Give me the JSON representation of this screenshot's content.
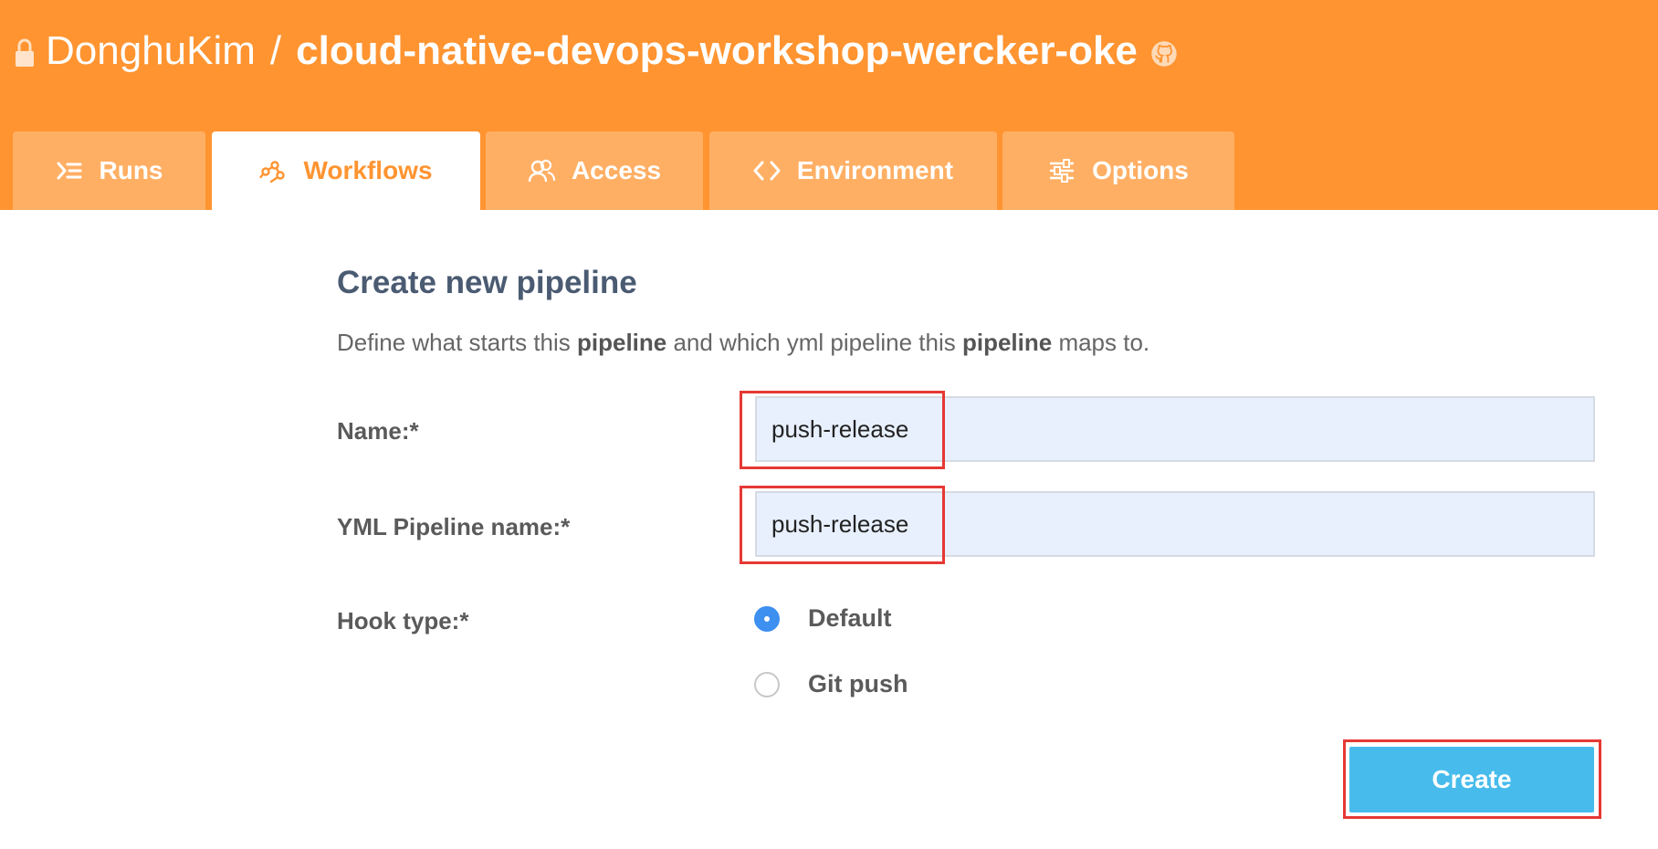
{
  "header": {
    "owner": "DonghuKim",
    "separator": "/",
    "repo_name": "cloud-native-devops-workshop-wercker-oke",
    "lock_icon": "lock-icon",
    "github_icon": "github-icon",
    "background_color": "#FF9431"
  },
  "tabs": [
    {
      "label": "Runs",
      "icon": "runs-icon",
      "active": false
    },
    {
      "label": "Workflows",
      "icon": "workflows-icon",
      "active": true
    },
    {
      "label": "Access",
      "icon": "access-icon",
      "active": false
    },
    {
      "label": "Environment",
      "icon": "code-icon",
      "active": false
    },
    {
      "label": "Options",
      "icon": "options-icon",
      "active": false
    }
  ],
  "form": {
    "title": "Create new pipeline",
    "description": {
      "part1": "Define what starts this ",
      "bold1": "pipeline",
      "part2": " and which yml pipeline this ",
      "bold2": "pipeline",
      "part3": " maps to."
    },
    "name_label": "Name:*",
    "name_value": "push-release",
    "yml_label": "YML Pipeline name:*",
    "yml_value": "push-release",
    "hook_label": "Hook type:*",
    "hook_options": [
      {
        "label": "Default",
        "checked": true
      },
      {
        "label": "Git push",
        "checked": false
      }
    ],
    "create_label": "Create"
  },
  "colors": {
    "accent": "#FF9431",
    "button": "#47BCEC",
    "radio_selected": "#3D8FF0",
    "highlight": "#E53935",
    "title": "#4A5B72"
  }
}
